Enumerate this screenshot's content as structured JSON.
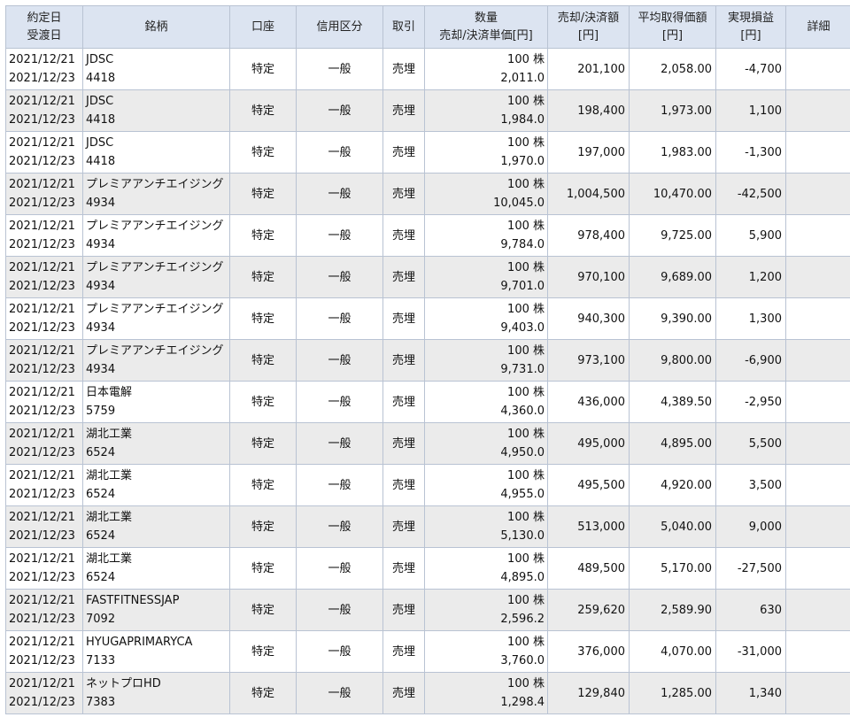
{
  "header_strip": {
    "text": "",
    "link": ""
  },
  "columns": {
    "date": [
      "約定日",
      "受渡日"
    ],
    "security": "銘柄",
    "account": "口座",
    "margin_type": "信用区分",
    "trade": "取引",
    "quantity": [
      "数量",
      "売却/決済単価[円]"
    ],
    "proceeds": [
      "売却/決済額",
      "[円]"
    ],
    "avg_cost": [
      "平均取得価額",
      "[円]"
    ],
    "realized_pl": [
      "実現損益",
      "[円]"
    ],
    "detail": "詳細"
  },
  "rows": [
    {
      "trade_date": "2021/12/21",
      "settle_date": "2021/12/23",
      "name": "JDSC",
      "code": "4418",
      "account": "特定",
      "margin": "一般",
      "trade": "売埋",
      "qty": "100 株",
      "price": "2,011.0",
      "proceeds": "201,100",
      "avg_cost": "2,058.00",
      "pl": "-4,700"
    },
    {
      "trade_date": "2021/12/21",
      "settle_date": "2021/12/23",
      "name": "JDSC",
      "code": "4418",
      "account": "特定",
      "margin": "一般",
      "trade": "売埋",
      "qty": "100 株",
      "price": "1,984.0",
      "proceeds": "198,400",
      "avg_cost": "1,973.00",
      "pl": "1,100"
    },
    {
      "trade_date": "2021/12/21",
      "settle_date": "2021/12/23",
      "name": "JDSC",
      "code": "4418",
      "account": "特定",
      "margin": "一般",
      "trade": "売埋",
      "qty": "100 株",
      "price": "1,970.0",
      "proceeds": "197,000",
      "avg_cost": "1,983.00",
      "pl": "-1,300"
    },
    {
      "trade_date": "2021/12/21",
      "settle_date": "2021/12/23",
      "name": "プレミアアンチエイジング",
      "code": "4934",
      "account": "特定",
      "margin": "一般",
      "trade": "売埋",
      "qty": "100 株",
      "price": "10,045.0",
      "proceeds": "1,004,500",
      "avg_cost": "10,470.00",
      "pl": "-42,500"
    },
    {
      "trade_date": "2021/12/21",
      "settle_date": "2021/12/23",
      "name": "プレミアアンチエイジング",
      "code": "4934",
      "account": "特定",
      "margin": "一般",
      "trade": "売埋",
      "qty": "100 株",
      "price": "9,784.0",
      "proceeds": "978,400",
      "avg_cost": "9,725.00",
      "pl": "5,900"
    },
    {
      "trade_date": "2021/12/21",
      "settle_date": "2021/12/23",
      "name": "プレミアアンチエイジング",
      "code": "4934",
      "account": "特定",
      "margin": "一般",
      "trade": "売埋",
      "qty": "100 株",
      "price": "9,701.0",
      "proceeds": "970,100",
      "avg_cost": "9,689.00",
      "pl": "1,200"
    },
    {
      "trade_date": "2021/12/21",
      "settle_date": "2021/12/23",
      "name": "プレミアアンチエイジング",
      "code": "4934",
      "account": "特定",
      "margin": "一般",
      "trade": "売埋",
      "qty": "100 株",
      "price": "9,403.0",
      "proceeds": "940,300",
      "avg_cost": "9,390.00",
      "pl": "1,300"
    },
    {
      "trade_date": "2021/12/21",
      "settle_date": "2021/12/23",
      "name": "プレミアアンチエイジング",
      "code": "4934",
      "account": "特定",
      "margin": "一般",
      "trade": "売埋",
      "qty": "100 株",
      "price": "9,731.0",
      "proceeds": "973,100",
      "avg_cost": "9,800.00",
      "pl": "-6,900"
    },
    {
      "trade_date": "2021/12/21",
      "settle_date": "2021/12/23",
      "name": "日本電解",
      "code": "5759",
      "account": "特定",
      "margin": "一般",
      "trade": "売埋",
      "qty": "100 株",
      "price": "4,360.0",
      "proceeds": "436,000",
      "avg_cost": "4,389.50",
      "pl": "-2,950"
    },
    {
      "trade_date": "2021/12/21",
      "settle_date": "2021/12/23",
      "name": "湖北工業",
      "code": "6524",
      "account": "特定",
      "margin": "一般",
      "trade": "売埋",
      "qty": "100 株",
      "price": "4,950.0",
      "proceeds": "495,000",
      "avg_cost": "4,895.00",
      "pl": "5,500"
    },
    {
      "trade_date": "2021/12/21",
      "settle_date": "2021/12/23",
      "name": "湖北工業",
      "code": "6524",
      "account": "特定",
      "margin": "一般",
      "trade": "売埋",
      "qty": "100 株",
      "price": "4,955.0",
      "proceeds": "495,500",
      "avg_cost": "4,920.00",
      "pl": "3,500"
    },
    {
      "trade_date": "2021/12/21",
      "settle_date": "2021/12/23",
      "name": "湖北工業",
      "code": "6524",
      "account": "特定",
      "margin": "一般",
      "trade": "売埋",
      "qty": "100 株",
      "price": "5,130.0",
      "proceeds": "513,000",
      "avg_cost": "5,040.00",
      "pl": "9,000"
    },
    {
      "trade_date": "2021/12/21",
      "settle_date": "2021/12/23",
      "name": "湖北工業",
      "code": "6524",
      "account": "特定",
      "margin": "一般",
      "trade": "売埋",
      "qty": "100 株",
      "price": "4,895.0",
      "proceeds": "489,500",
      "avg_cost": "5,170.00",
      "pl": "-27,500"
    },
    {
      "trade_date": "2021/12/21",
      "settle_date": "2021/12/23",
      "name": "FASTFITNESSJAP",
      "code": "7092",
      "account": "特定",
      "margin": "一般",
      "trade": "売埋",
      "qty": "100 株",
      "price": "2,596.2",
      "proceeds": "259,620",
      "avg_cost": "2,589.90",
      "pl": "630"
    },
    {
      "trade_date": "2021/12/21",
      "settle_date": "2021/12/23",
      "name": "HYUGAPRIMARYCA",
      "code": "7133",
      "account": "特定",
      "margin": "一般",
      "trade": "売埋",
      "qty": "100 株",
      "price": "3,760.0",
      "proceeds": "376,000",
      "avg_cost": "4,070.00",
      "pl": "-31,000"
    },
    {
      "trade_date": "2021/12/21",
      "settle_date": "2021/12/23",
      "name": "ネットプロHD",
      "code": "7383",
      "account": "特定",
      "margin": "一般",
      "trade": "売埋",
      "qty": "100 株",
      "price": "1,298.4",
      "proceeds": "129,840",
      "avg_cost": "1,285.00",
      "pl": "1,340"
    }
  ],
  "colors": {
    "header_bg": "#dce4f1",
    "border": "#b9c3d3",
    "shaded_row": "#ebebeb"
  }
}
